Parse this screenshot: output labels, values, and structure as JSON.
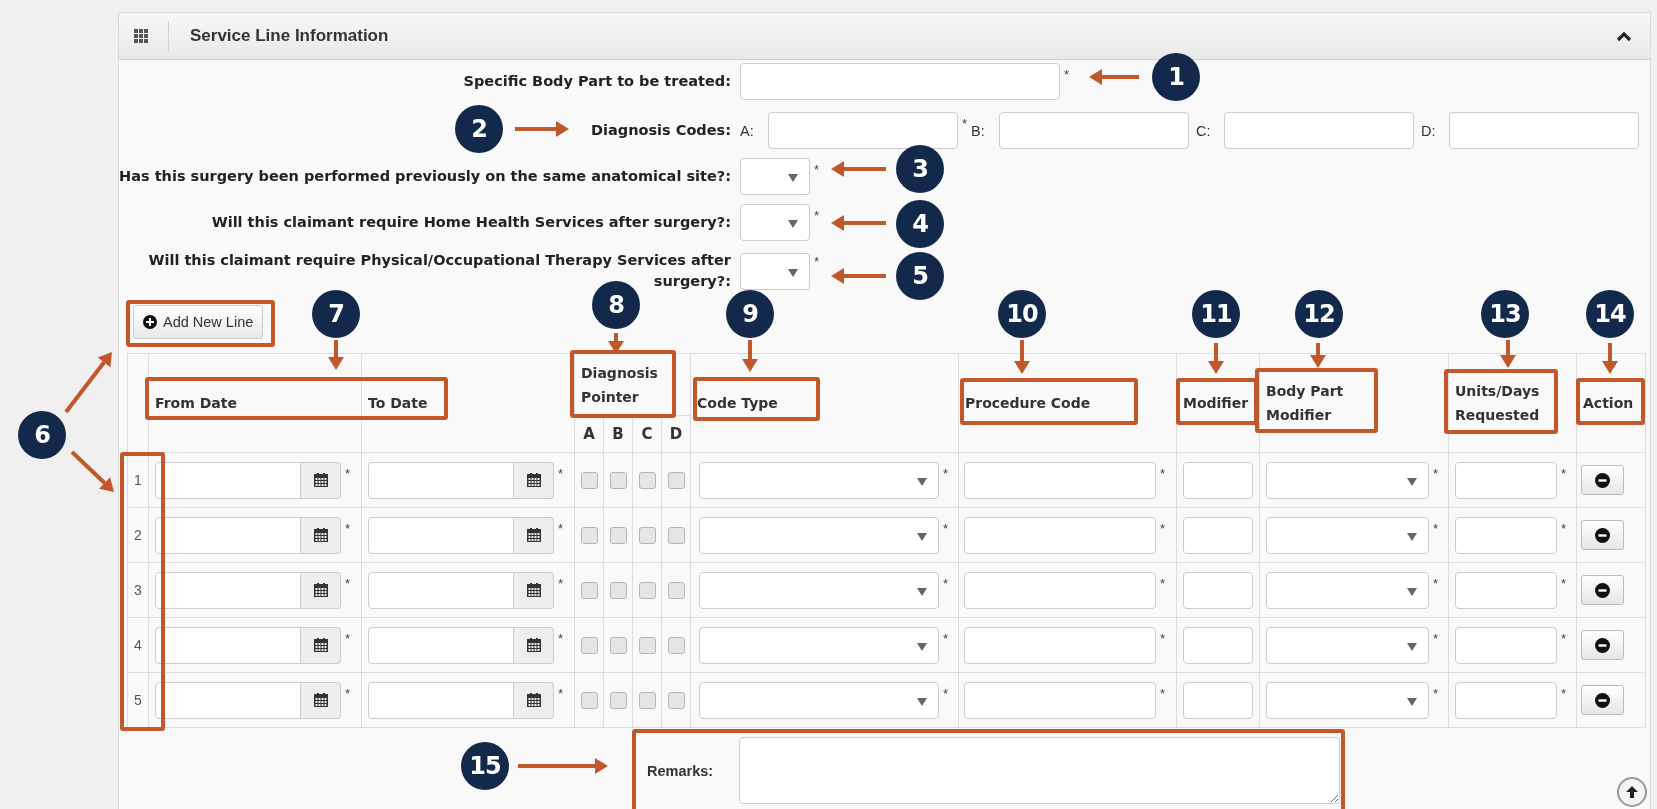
{
  "panel": {
    "title": "Service Line Information"
  },
  "body_part": {
    "label": "Specific Body Part to be treated:",
    "mark": "*"
  },
  "diagnosis_codes": {
    "label": "Diagnosis Codes:",
    "codes": [
      {
        "letter": "A:",
        "mark": "*"
      },
      {
        "letter": "B:"
      },
      {
        "letter": "C:"
      },
      {
        "letter": "D:"
      }
    ]
  },
  "questions": [
    {
      "label": "Has this surgery been performed previously on the same anatomical site?:",
      "mark": "*"
    },
    {
      "label": "Will this claimant require Home Health Services after surgery?:",
      "mark": "*"
    },
    {
      "label": "Will this claimant require Physical/Occupational Therapy Services after surgery?:",
      "mark": "*"
    }
  ],
  "add_button": {
    "label": "Add New Line"
  },
  "table": {
    "columns": [
      {
        "label": "From Date"
      },
      {
        "label": "To Date"
      },
      {
        "label": "Diagnosis Pointer",
        "sub": [
          "A",
          "B",
          "C",
          "D"
        ]
      },
      {
        "label": "Code Type"
      },
      {
        "label": "Procedure Code"
      },
      {
        "label": "Modifier"
      },
      {
        "label": "Body Part Modifier"
      },
      {
        "label": "Units/Days Requested"
      },
      {
        "label": "Action"
      }
    ],
    "rows": [
      {
        "number": "1",
        "from_mark": "*",
        "to_mark": "*",
        "pointers": [
          {
            "checked": false
          },
          {
            "checked": false
          },
          {
            "checked": false
          },
          {
            "checked": false
          }
        ],
        "code_type_mark": "*",
        "procedure_mark": "*",
        "body_part_mark": "*",
        "units_mark": "*"
      },
      {
        "number": "2",
        "from_mark": "*",
        "to_mark": "*",
        "pointers": [
          {
            "checked": false
          },
          {
            "checked": false
          },
          {
            "checked": false
          },
          {
            "checked": false
          }
        ],
        "code_type_mark": "*",
        "procedure_mark": "*",
        "body_part_mark": "*",
        "units_mark": "*"
      },
      {
        "number": "3",
        "from_mark": "*",
        "to_mark": "*",
        "pointers": [
          {
            "checked": false
          },
          {
            "checked": false
          },
          {
            "checked": false
          },
          {
            "checked": false
          }
        ],
        "code_type_mark": "*",
        "procedure_mark": "*",
        "body_part_mark": "*",
        "units_mark": "*"
      },
      {
        "number": "4",
        "from_mark": "*",
        "to_mark": "*",
        "pointers": [
          {
            "checked": false
          },
          {
            "checked": false
          },
          {
            "checked": false
          },
          {
            "checked": false
          }
        ],
        "code_type_mark": "*",
        "procedure_mark": "*",
        "body_part_mark": "*",
        "units_mark": "*"
      },
      {
        "number": "5",
        "from_mark": "*",
        "to_mark": "*",
        "pointers": [
          {
            "checked": false
          },
          {
            "checked": false
          },
          {
            "checked": false
          },
          {
            "checked": false
          }
        ],
        "code_type_mark": "*",
        "procedure_mark": "*",
        "body_part_mark": "*",
        "units_mark": "*"
      }
    ]
  },
  "remarks": {
    "label": "Remarks:"
  },
  "callouts": [
    {
      "label": "1"
    },
    {
      "label": "2"
    },
    {
      "label": "3"
    },
    {
      "label": "4"
    },
    {
      "label": "5"
    },
    {
      "label": "6"
    },
    {
      "label": "7"
    },
    {
      "label": "8"
    },
    {
      "label": "9"
    },
    {
      "label": "10"
    },
    {
      "label": "11"
    },
    {
      "label": "12"
    },
    {
      "label": "13"
    },
    {
      "label": "14"
    },
    {
      "label": "15"
    }
  ]
}
